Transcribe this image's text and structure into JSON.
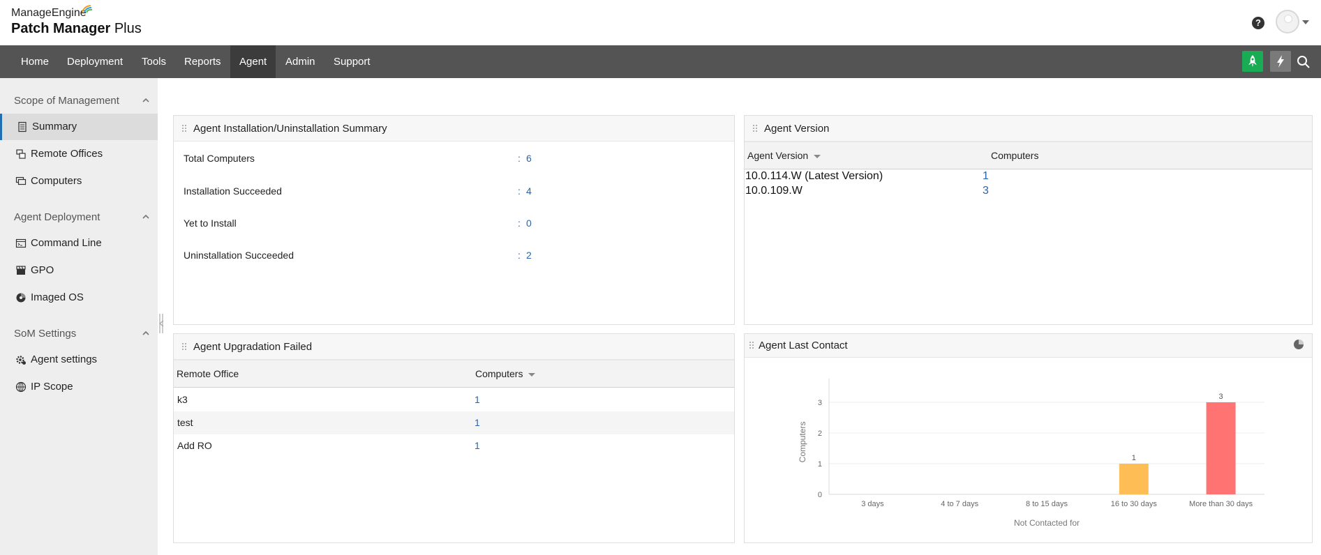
{
  "brand": {
    "vendor": "ManageEngine",
    "product_bold": "Patch Manager",
    "product_light": " Plus"
  },
  "header": {
    "help_label": "?"
  },
  "nav": {
    "items": [
      {
        "label": "Home"
      },
      {
        "label": "Deployment"
      },
      {
        "label": "Tools"
      },
      {
        "label": "Reports"
      },
      {
        "label": "Agent",
        "active": true
      },
      {
        "label": "Admin"
      },
      {
        "label": "Support"
      }
    ],
    "accent_green": "#1aab55"
  },
  "sidebar": {
    "sections": [
      {
        "title": "Scope of Management",
        "items": [
          {
            "label": "Summary",
            "icon": "document-icon",
            "active": true
          },
          {
            "label": "Remote Offices",
            "icon": "remote-offices-icon"
          },
          {
            "label": "Computers",
            "icon": "computers-icon"
          }
        ]
      },
      {
        "title": "Agent Deployment",
        "items": [
          {
            "label": "Command Line",
            "icon": "command-line-icon"
          },
          {
            "label": "GPO",
            "icon": "gpo-icon"
          },
          {
            "label": "Imaged OS",
            "icon": "imaged-os-icon"
          }
        ]
      },
      {
        "title": "SoM Settings",
        "items": [
          {
            "label": "Agent settings",
            "icon": "agent-settings-icon"
          },
          {
            "label": "IP Scope",
            "icon": "ip-scope-icon"
          }
        ]
      }
    ]
  },
  "install_summary": {
    "title": "Agent Installation/Uninstallation Summary",
    "rows": [
      {
        "label": "Total Computers",
        "colon": ":",
        "value": "6"
      },
      {
        "label": "Installation Succeeded",
        "colon": ":",
        "value": "4"
      },
      {
        "label": "Yet to Install",
        "colon": ":",
        "value": "0"
      },
      {
        "label": "Uninstallation Succeeded",
        "colon": ":",
        "value": "2"
      }
    ]
  },
  "agent_version": {
    "title": "Agent Version",
    "columns": [
      "Agent Version",
      "Computers"
    ],
    "rows": [
      {
        "version": "10.0.114.W (Latest Version)",
        "computers": "1"
      },
      {
        "version": "10.0.109.W",
        "computers": "3"
      }
    ]
  },
  "upgrade_failed": {
    "title": "Agent Upgradation Failed",
    "columns": [
      "Remote Office",
      "Computers"
    ],
    "rows": [
      {
        "office": "k3",
        "computers": "1"
      },
      {
        "office": "test",
        "computers": "1"
      },
      {
        "office": "Add RO",
        "computers": "1"
      }
    ]
  },
  "last_contact": {
    "title": "Agent Last Contact"
  },
  "chart_data": {
    "type": "bar",
    "title": "",
    "xlabel": "Not Contacted for",
    "ylabel": "Computers",
    "categories": [
      "3 days",
      "4 to 7 days",
      "8 to 15 days",
      "16 to 30 days",
      "More than 30 days"
    ],
    "values": [
      0,
      0,
      0,
      1,
      3
    ],
    "data_labels": [
      "",
      "",
      "",
      "1",
      "3"
    ],
    "bar_colors": [
      "#ffbe55",
      "#ffbe55",
      "#ffbe55",
      "#ffbe55",
      "#ff7373"
    ],
    "yticks": [
      "0",
      "1",
      "2",
      "3"
    ],
    "ylim": [
      0,
      3.5
    ],
    "grid": true
  }
}
